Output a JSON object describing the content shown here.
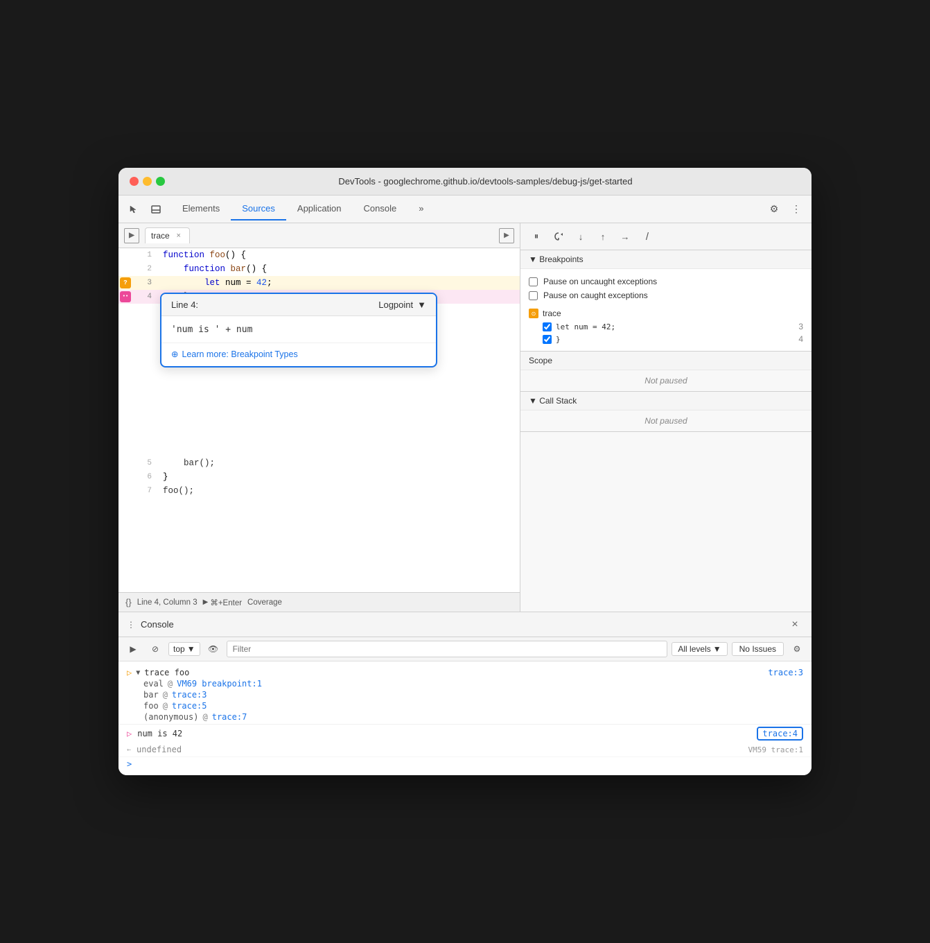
{
  "window": {
    "title": "DevTools - googlechrome.github.io/devtools-samples/debug-js/get-started"
  },
  "toolbar": {
    "tabs": [
      {
        "label": "Elements",
        "active": false
      },
      {
        "label": "Sources",
        "active": true
      },
      {
        "label": "Application",
        "active": false
      },
      {
        "label": "Console",
        "active": false
      }
    ],
    "more_label": "»",
    "settings_label": "⚙",
    "more_options_label": "⋮"
  },
  "file_panel": {
    "open_icon": "▶",
    "file_tab": "trace",
    "close_icon": "×",
    "right_icon": "▶"
  },
  "code": {
    "lines": [
      {
        "num": 1,
        "content": "function foo() {",
        "gutter": null
      },
      {
        "num": 2,
        "content": "    function bar() {",
        "gutter": null
      },
      {
        "num": 3,
        "content": "        let num = 42;",
        "gutter": "?",
        "gutter_type": "yellow"
      },
      {
        "num": 4,
        "content": "    }",
        "gutter": "••",
        "gutter_type": "pink"
      },
      {
        "num": 5,
        "content": "    bar();",
        "gutter": null
      },
      {
        "num": 6,
        "content": "}",
        "gutter": null
      },
      {
        "num": 7,
        "content": "foo();",
        "gutter": null
      }
    ]
  },
  "logpoint_popup": {
    "line_label": "Line 4:",
    "type_label": "Logpoint",
    "dropdown_icon": "▼",
    "input_value": "'num is ' + num",
    "link_text": "Learn more: Breakpoint Types",
    "link_icon": "⊕"
  },
  "debug_toolbar": {
    "pause_icon": "⏸",
    "refresh_icon": "↺",
    "step_over_icon": "↷",
    "step_into_icon": "↑",
    "step_out_icon": "↓",
    "continue_icon": "→",
    "deactivate_icon": "/"
  },
  "breakpoints": {
    "section_title": "▼ Breakpoints",
    "pause_uncaught": "Pause on uncaught exceptions",
    "pause_caught": "Pause on caught exceptions",
    "entries": [
      {
        "file_name": "trace",
        "icon_type": "orange",
        "items": [
          {
            "code": "let num = 42;",
            "line": "3",
            "checked": true
          },
          {
            "code": "}",
            "line": "4",
            "checked": true
          }
        ]
      }
    ]
  },
  "scope": {
    "title": "Scope",
    "not_paused": "Not paused"
  },
  "call_stack": {
    "title": "▼ Call Stack",
    "not_paused": "Not paused"
  },
  "status_bar": {
    "braces_icon": "{}",
    "position": "Line 4, Column 3",
    "run_icon": "▶",
    "run_shortcut": "⌘+Enter",
    "coverage": "Coverage"
  },
  "console": {
    "title": "Console",
    "close_icon": "×",
    "toolbar": {
      "play_icon": "▶",
      "block_icon": "⊘",
      "top_label": "top",
      "dropdown_icon": "▼",
      "eye_icon": "👁",
      "filter_placeholder": "Filter",
      "levels_label": "All levels",
      "levels_dropdown": "▼",
      "no_issues_label": "No Issues",
      "settings_icon": "⚙"
    },
    "entries": [
      {
        "type": "trace_group",
        "icon": "▶",
        "name": "trace foo",
        "link": "trace:3",
        "sub_entries": [
          {
            "name": "eval",
            "link": "VM69 breakpoint:1"
          },
          {
            "name": "bar",
            "link": "trace:3"
          },
          {
            "name": "foo",
            "link": "trace:5"
          },
          {
            "name": "(anonymous)",
            "link": "trace:7"
          }
        ]
      },
      {
        "type": "output",
        "icon": "▷",
        "icon_type": "pink",
        "text": "num is 42",
        "link": "trace:4",
        "highlighted": true
      },
      {
        "type": "undefined_output",
        "icon": "←",
        "text": "undefined",
        "link": "VM59  trace:1"
      }
    ],
    "prompt_icon": ">"
  }
}
